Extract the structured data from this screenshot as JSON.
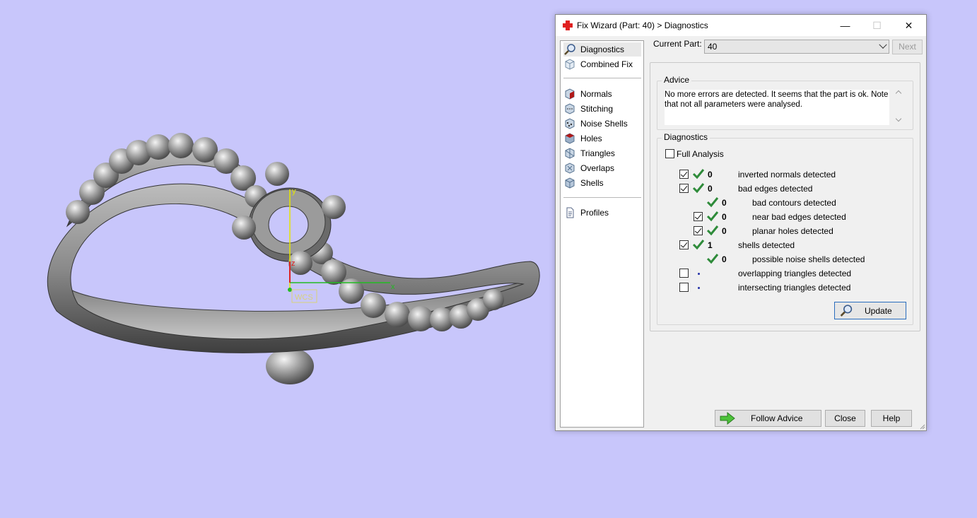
{
  "viewport": {
    "background": "#c8c6fb",
    "axis_labels": {
      "x": "x",
      "y": "y",
      "z": "z",
      "wcs": "WCS"
    }
  },
  "dialog": {
    "title": "Fix Wizard (Part: 40) > Diagnostics",
    "title_icon": "red-cross-icon",
    "window_buttons": {
      "minimize": "—",
      "maximize": "☐",
      "close": "✕"
    }
  },
  "nav": {
    "items": [
      {
        "label": "Diagnostics",
        "icon": "magnifier-icon",
        "selected": true
      },
      {
        "label": "Combined Fix",
        "icon": "cube-icon"
      },
      {
        "label": "Normals",
        "icon": "normals-cube-icon"
      },
      {
        "label": "Stitching",
        "icon": "stitching-cube-icon"
      },
      {
        "label": "Noise Shells",
        "icon": "noise-shells-icon"
      },
      {
        "label": "Holes",
        "icon": "holes-cube-icon"
      },
      {
        "label": "Triangles",
        "icon": "triangles-cube-icon"
      },
      {
        "label": "Overlaps",
        "icon": "overlaps-cube-icon"
      },
      {
        "label": "Shells",
        "icon": "shells-cube-icon"
      },
      {
        "label": "Profiles",
        "icon": "document-icon"
      }
    ]
  },
  "current_part": {
    "label": "Current Part:",
    "value": "40"
  },
  "next_button": "Next",
  "advice": {
    "title": "Advice",
    "text": "No more errors are detected. It seems that the part is ok. Note that not all parameters were analysed."
  },
  "diagnostics": {
    "title": "Diagnostics",
    "full_analysis_label": "Full Analysis",
    "full_analysis_checked": false,
    "rows": [
      {
        "checked": true,
        "count": "0",
        "label": "inverted normals detected",
        "status": "ok",
        "indent": 0
      },
      {
        "checked": true,
        "count": "0",
        "label": "bad edges detected",
        "status": "ok",
        "indent": 0
      },
      {
        "checkbox": false,
        "count": "0",
        "label": "bad contours detected",
        "status": "ok",
        "indent": 1
      },
      {
        "checked": true,
        "count": "0",
        "label": "near bad edges detected",
        "status": "ok",
        "indent": 1
      },
      {
        "checked": true,
        "count": "0",
        "label": "planar holes detected",
        "status": "ok",
        "indent": 1
      },
      {
        "checked": true,
        "count": "1",
        "label": "shells detected",
        "status": "ok",
        "indent": 0
      },
      {
        "checkbox": false,
        "count": "0",
        "label": "possible noise shells detected",
        "status": "ok",
        "indent": 1
      },
      {
        "checked": false,
        "count": "",
        "label": "overlapping triangles detected",
        "status": "not-run",
        "indent": 0
      },
      {
        "checked": false,
        "count": "",
        "label": "intersecting triangles detected",
        "status": "not-run",
        "indent": 0
      }
    ],
    "update_button": "Update"
  },
  "footer": {
    "follow_advice": "Follow Advice",
    "close": "Close",
    "help": "Help"
  },
  "colors": {
    "accent": "#2a6dbd",
    "check_green": "#2e8b3a",
    "not_run_dot": "#2432a8"
  }
}
